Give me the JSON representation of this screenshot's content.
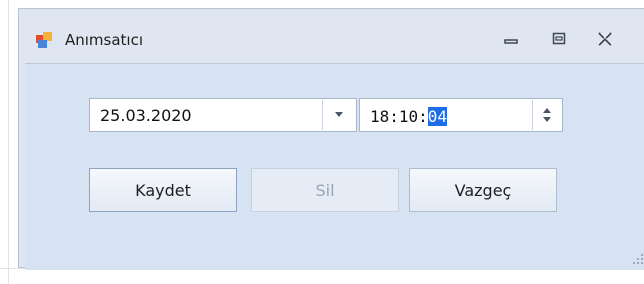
{
  "window": {
    "title": "Anımsatıcı",
    "controls": {
      "minimize_icon": "minimize-icon",
      "maximize_icon": "restore-icon",
      "close_icon": "close-icon"
    }
  },
  "form": {
    "date_value": "25.03.2020",
    "time_prefix": "18:10:",
    "time_selected": "04"
  },
  "buttons": {
    "save_label": "Kaydet",
    "delete_label": "Sil",
    "cancel_label": "Vazgeç"
  },
  "colors": {
    "window_bg": "#dfe6f2",
    "client_bg": "#d7e2f2",
    "selection": "#1e6ce6"
  }
}
